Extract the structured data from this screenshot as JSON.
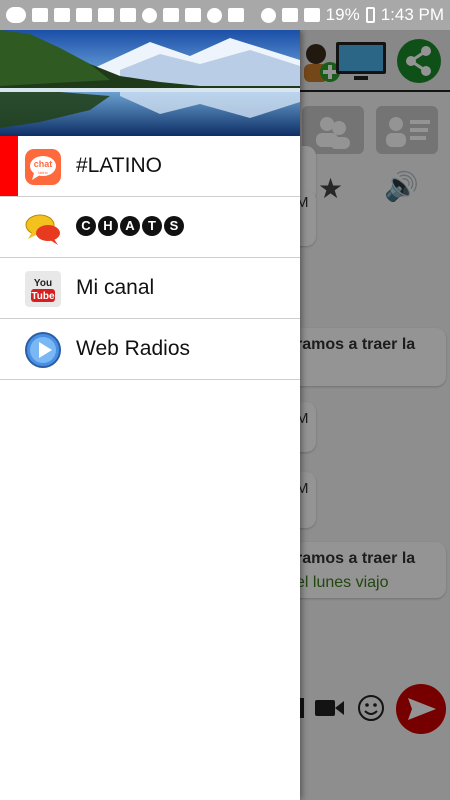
{
  "status_bar": {
    "battery": "19%",
    "time": "1:43 PM"
  },
  "drawer": {
    "items": [
      {
        "label": "#LATINO",
        "icon": "chat-latino-icon",
        "active": true
      },
      {
        "label": "CHATS",
        "icon": "chat-bubbles-icon",
        "active": false
      },
      {
        "label": "Mi canal",
        "icon": "youtube-icon",
        "active": false
      },
      {
        "label": "Web Radios",
        "icon": "play-circle-icon",
        "active": false
      }
    ],
    "app_icon_text": {
      "top": "chat",
      "bottom": "latino"
    }
  },
  "background_chat": {
    "message_time_1": "M",
    "message_time_2": "M",
    "message_time_3": "M",
    "message_text_1": "ramos a traer la",
    "message_text_2": "ramos a traer la",
    "message_text_3": "el lunes viajo"
  },
  "colors": {
    "active_marker": "#ff0000",
    "status_bar": "#a8a8a8",
    "send_button": "#cc0000",
    "share_button": "#1a8a2a"
  }
}
